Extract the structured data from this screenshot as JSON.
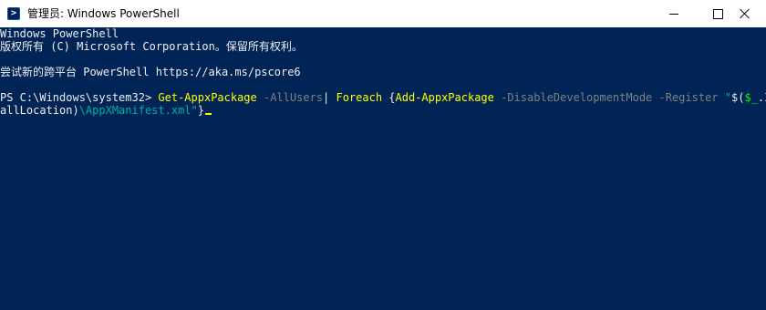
{
  "window": {
    "title": "管理员: Windows PowerShell",
    "icon": "powershell-icon",
    "controls": [
      "minimize-icon",
      "maximize-icon",
      "close-icon"
    ]
  },
  "console": {
    "background": "#012456",
    "foreground": "#EEEDF0",
    "lines": {
      "l1": "Windows PowerShell",
      "l2": "版权所有 (C) Microsoft Corporation。保留所有权利。",
      "l3": "尝试新的跨平台 PowerShell https://aka.ms/pscore6"
    },
    "command": {
      "prompt": "PS C:\\Windows\\system32> ",
      "cmd1": "Get-AppxPackage",
      "param1": " -AllUsers",
      "pipe": "| ",
      "cmd2": "Foreach",
      "brace_open": " {",
      "cmd3": "Add-AppxPackage",
      "param2": " -DisableDevelopmentMode -Register ",
      "str_start": "\"",
      "dollar_paren": "$(",
      "var": "$_",
      "member": ".Inst",
      "member_cont": "allLocation)",
      "str_end": "\\AppXManifest.xml\"",
      "brace_close": "}"
    }
  },
  "colors": {
    "command": "#FFFF00",
    "parameter": "#808080",
    "string": "#00B0A0",
    "variable": "#00FF00"
  }
}
